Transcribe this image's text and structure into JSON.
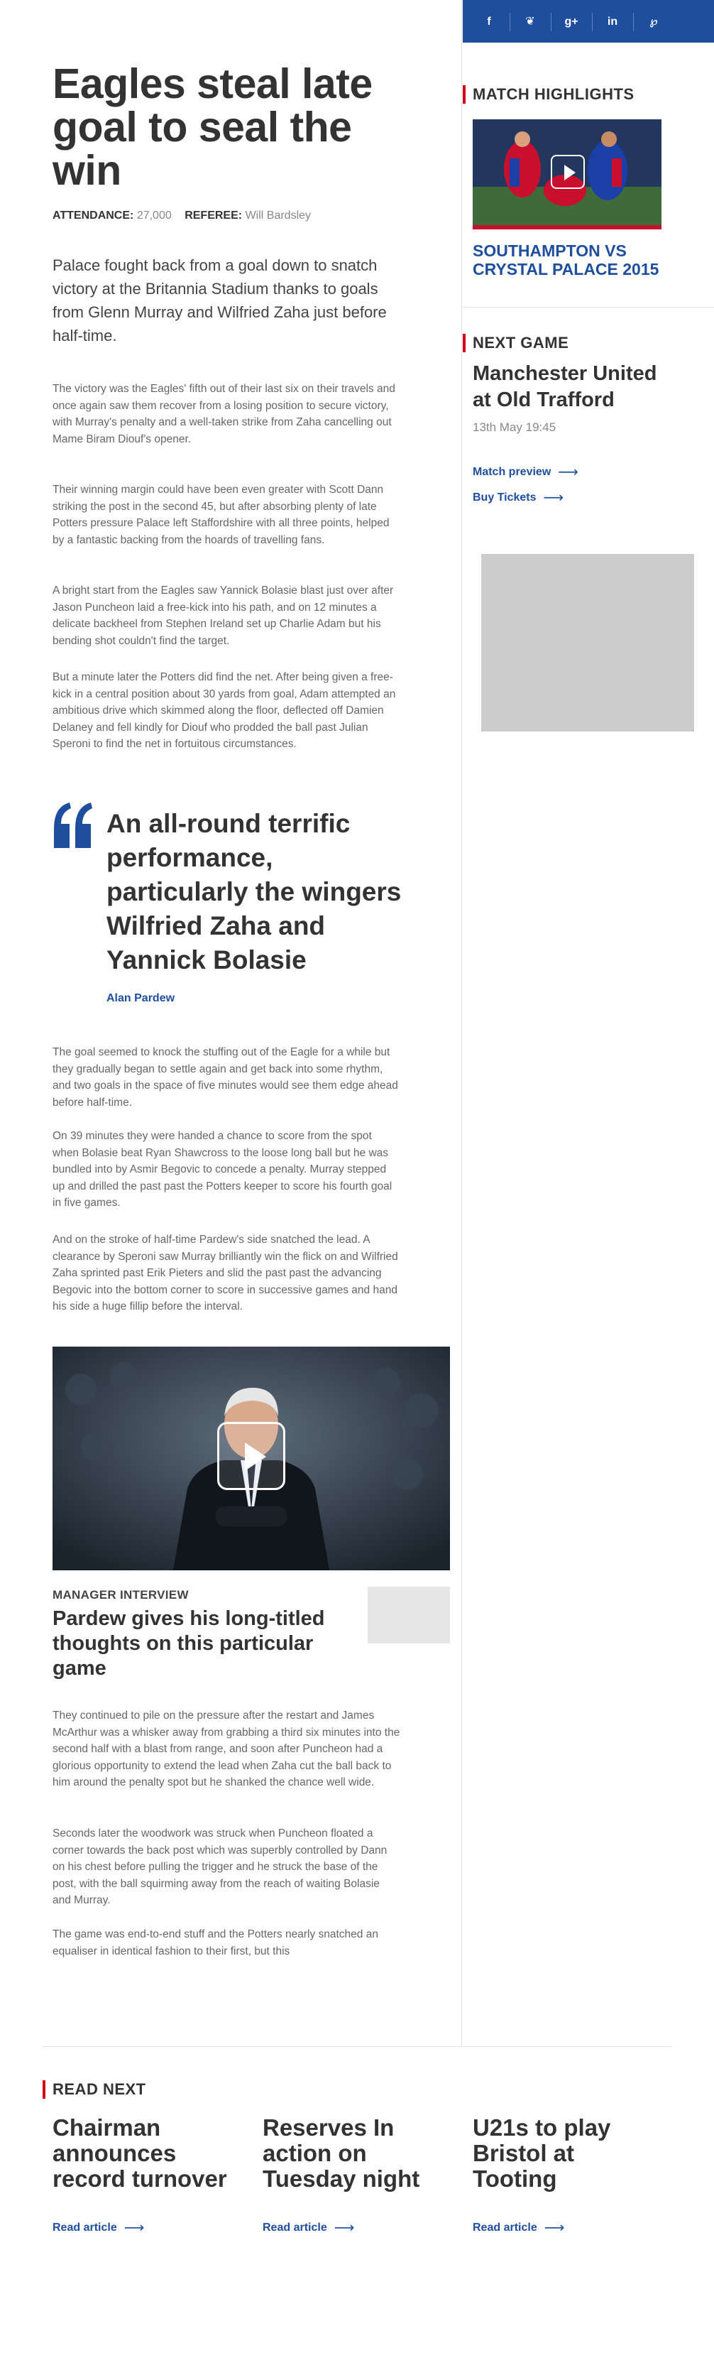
{
  "article": {
    "headline": "Eagles steal late goal to seal the win",
    "attendance_label": "ATTENDANCE:",
    "attendance_value": "27,000",
    "referee_label": "REFEREE:",
    "referee_value": "Will Bardsley",
    "lede": "Palace fought back from a goal down to snatch victory at the Britannia Stadium thanks to goals from Glenn Murray and Wilfried Zaha just before half-time.",
    "paragraphs": [
      "The victory was the Eagles' fifth out of their last six on their travels and once again saw them recover from a losing position to secure victory, with Murray's penalty and a well-taken strike from Zaha cancelling out Mame Biram Diouf's opener.",
      "Their winning margin could have been even greater with Scott Dann striking the post in the second 45, but after absorbing plenty of late Potters pressure Palace left Staffordshire with all three points, helped by a fantastic backing from the hoards of travelling fans.",
      "A bright start from the Eagles saw Yannick Bolasie blast just over after Jason Puncheon laid a free-kick into his path, and on 12 minutes a delicate backheel from Stephen Ireland set up Charlie Adam but his bending shot couldn't find the target.",
      "But a minute later the Potters did find the net. After being given a free-kick in a central position about 30 yards from goal, Adam attempted an ambitious drive which skimmed along the floor, deflected off Damien Delaney and fell kindly for Diouf who prodded the ball past Julian Speroni to find the net in fortuitous circumstances.",
      "The goal seemed to knock the stuffing out of the Eagle for a while but they gradually began to settle again and get back into some rhythm, and two goals in the space of five minutes would see them edge ahead before half-time.",
      "On 39 minutes they were handed a chance to score from the spot when Bolasie beat Ryan Shawcross to the loose long ball but he was bundled into by Asmir Begovic to concede a penalty. Murray stepped up and drilled the past past the Potters keeper to score his fourth goal in five games.",
      "And on the stroke of half-time Pardew's side snatched the lead. A clearance by Speroni saw Murray brilliantly win the flick on and Wilfried Zaha sprinted past Erik Pieters and slid the past past the advancing Begovic into the bottom corner to score in successive games and hand his side a huge fillip before the interval.",
      "They continued to pile on the pressure after the restart and James McArthur was a whisker away from grabbing a third six minutes into the second half with a blast from range, and soon after Puncheon had a glorious opportunity to extend the lead when Zaha cut the ball back to him around the penalty spot but he shanked the chance well wide.",
      "Seconds later the woodwork was struck when Puncheon floated a corner towards the back post which was superbly controlled by Dann on his chest before pulling the trigger and he struck the base of the post, with the ball squirming away from the reach of waiting Bolasie and Murray.",
      "The game was end-to-end stuff and the Potters nearly snatched an equaliser in identical fashion to their first, but this"
    ],
    "quote": {
      "text": "An all-round terrific performance, particularly the wingers Wilfried Zaha and Yannick Bolasie",
      "author": "Alan Pardew"
    },
    "video": {
      "kicker": "MANAGER INTERVIEW",
      "title": "Pardew gives his long-titled thoughts on this particular game",
      "play_icon": "play-icon"
    }
  },
  "sidebar": {
    "social": [
      {
        "icon": "facebook-icon",
        "glyph": "f"
      },
      {
        "icon": "twitter-icon",
        "glyph": "❦"
      },
      {
        "icon": "googleplus-icon",
        "glyph": "g+"
      },
      {
        "icon": "linkedin-icon",
        "glyph": "in"
      },
      {
        "icon": "pinterest-icon",
        "glyph": "℘"
      }
    ],
    "highlights": {
      "heading": "MATCH HIGHLIGHTS",
      "title": "SOUTHAMPTON VS CRYSTAL PALACE 2015"
    },
    "next_game": {
      "heading": "NEXT GAME",
      "title": "Manchester United at Old Trafford",
      "date": "13th May 19:45",
      "links": [
        "Match preview",
        "Buy Tickets"
      ]
    }
  },
  "read_next": {
    "heading": "READ NEXT",
    "cards": [
      {
        "title": "Chairman announces record turnover",
        "link": "Read article"
      },
      {
        "title": "Reserves In action on Tuesday night",
        "link": "Read article"
      },
      {
        "title": "U21s to play Bristol at Tooting",
        "link": "Read article"
      }
    ]
  },
  "colors": {
    "brand_blue": "#1f4e9e",
    "accent_red": "#d0021b",
    "placeholder_grey": "#cccccc"
  }
}
